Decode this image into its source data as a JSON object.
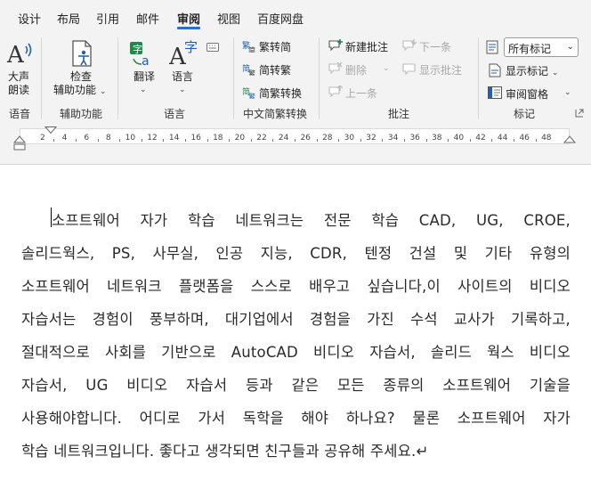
{
  "tabs": [
    "设计",
    "布局",
    "引用",
    "邮件",
    "审阅",
    "视图",
    "百度网盘"
  ],
  "active_tab": "审阅",
  "ribbon": {
    "read_aloud": {
      "line1": "大声",
      "line2": "朗读",
      "group": "语音"
    },
    "accessibility": {
      "line1": "检查",
      "line2": "辅助功能",
      "group": "辅助功能"
    },
    "language": {
      "translate": "翻译",
      "language": "语言",
      "group": "语言"
    },
    "chinese_conversion": {
      "to_simplified": "繁转简",
      "to_traditional": "简转繁",
      "convert": "简繁转换",
      "group": "中文简繁转换"
    },
    "comments": {
      "new": "新建批注",
      "delete": "删除",
      "previous": "上一条",
      "next": "下一条",
      "show": "显示批注",
      "group": "批注"
    },
    "tracking": {
      "markup_select": "所有标记",
      "show_markup": "显示标记",
      "review_pane": "审阅窗格",
      "group": "标记"
    }
  },
  "ruler": {
    "numbers": [
      "2",
      "4",
      "6",
      "8",
      "10",
      "12",
      "14",
      "16",
      "18",
      "20",
      "22",
      "24",
      "26",
      "28",
      "30",
      "32",
      "34",
      "36",
      "38",
      "40",
      "42",
      "44",
      "46",
      "48"
    ]
  },
  "document": {
    "lines": [
      "소프트웨어 자가 학습 네트워크는 전문 학습 CAD, UG, CROE,",
      "솔리드웍스, PS, 사무실, 인공 지능, CDR, 텐정 건설 및 기타 유형의",
      "소프트웨어 네트워크 플랫폼을 스스로 배우고 싶습니다,이 사이트의 비디오",
      "자습서는 경험이 풍부하며, 대기업에서 경험을 가진 수석 교사가 기록하고,",
      "절대적으로 사회를 기반으로 AutoCAD 비디오 자습서, 솔리드 웍스 비디오",
      "자습서, UG 비디오 자습서 등과 같은 모든 종류의 소프트웨어 기술을",
      "사용해야합니다. 어디로 가서 독학을 해야 하나요? 물론 소프트웨어 자가",
      "학습 네트워크입니다. 좋다고 생각되면 친구들과 공유해 주세요.↵"
    ]
  },
  "colors": {
    "accent": "#2b6fc7",
    "icon_blue": "#1f5fb4",
    "icon_green": "#1d8a4a",
    "chrome": "#f3f3f3"
  }
}
